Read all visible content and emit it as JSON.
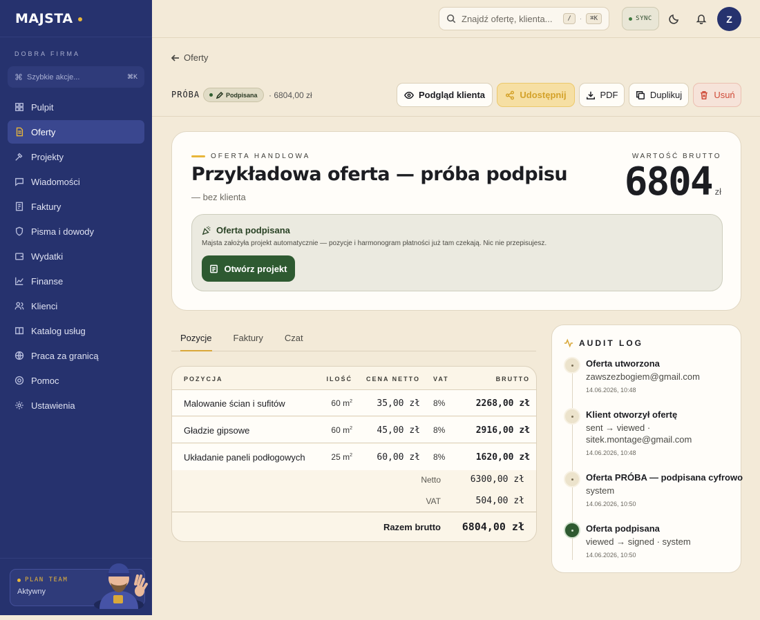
{
  "sidebar": {
    "brand": "MAJSTA",
    "org_label": "DOBRA FIRMA",
    "quick_actions": {
      "placeholder": "Szybkie akcje...",
      "shortcut": "⌘K"
    },
    "items": [
      {
        "label": "Pulpit",
        "icon": "dashboard-icon"
      },
      {
        "label": "Oferty",
        "icon": "document-icon",
        "active": true
      },
      {
        "label": "Projekty",
        "icon": "hammer-icon"
      },
      {
        "label": "Wiadomości",
        "icon": "message-icon"
      },
      {
        "label": "Faktury",
        "icon": "invoice-icon"
      },
      {
        "label": "Pisma i dowody",
        "icon": "shield-icon"
      },
      {
        "label": "Wydatki",
        "icon": "wallet-icon"
      },
      {
        "label": "Finanse",
        "icon": "chart-icon"
      },
      {
        "label": "Klienci",
        "icon": "users-icon"
      },
      {
        "label": "Katalog usług",
        "icon": "book-icon"
      },
      {
        "label": "Praca za granicą",
        "icon": "globe-icon"
      },
      {
        "label": "Pomoc",
        "icon": "help-icon"
      },
      {
        "label": "Ustawienia",
        "icon": "gear-icon"
      }
    ],
    "plan": {
      "tag": "PLAN TEAM",
      "status": "Aktywny"
    }
  },
  "topbar": {
    "search_placeholder": "Znajdź ofertę, klienta...",
    "search_key1": "/",
    "search_sep": "·",
    "search_key2": "⌘K",
    "sync_label": "SYNC",
    "avatar_initial": "Z"
  },
  "header": {
    "back_label": "Oferty",
    "doc_code": "PRÓBA",
    "status": "Podpisana",
    "amount": "· 6804,00 zł",
    "buttons": {
      "preview": "Podgląd klienta",
      "share": "Udostępnij",
      "pdf": "PDF",
      "duplicate": "Duplikuj",
      "delete": "Usuń"
    }
  },
  "offer": {
    "eyebrow": "OFERTA HANDLOWA",
    "title": "Przykładowa oferta — próba podpisu",
    "client": "— bez klienta",
    "gross_label": "WARTOŚĆ BRUTTO",
    "gross_value": "6804",
    "gross_currency": "zł",
    "signed": {
      "title": "Oferta podpisana",
      "description": "Majsta założyła projekt automatycznie — pozycje i harmonogram płatności już tam czekają. Nic nie przepisujesz.",
      "button": "Otwórz projekt"
    }
  },
  "tabs": [
    "Pozycje",
    "Faktury",
    "Czat"
  ],
  "items_table": {
    "headers": {
      "position": "POZYCJA",
      "qty": "ILOŚĆ",
      "net": "CENA NETTO",
      "vat": "VAT",
      "gross": "BRUTTO"
    },
    "rows": [
      {
        "name": "Malowanie ścian i sufitów",
        "qty": "60 m",
        "qty_sup": "2",
        "net": "35,00 zł",
        "vat": "8%",
        "gross": "2268,00 zł"
      },
      {
        "name": "Gładzie gipsowe",
        "qty": "60 m",
        "qty_sup": "2",
        "net": "45,00 zł",
        "vat": "8%",
        "gross": "2916,00 zł"
      },
      {
        "name": "Układanie paneli podłogowych",
        "qty": "25 m",
        "qty_sup": "2",
        "net": "60,00 zł",
        "vat": "8%",
        "gross": "1620,00 zł"
      }
    ],
    "summary": {
      "net_label": "Netto",
      "net_value": "6300,00 zł",
      "vat_label": "VAT",
      "vat_value": "504,00 zł",
      "total_label": "Razem brutto",
      "total_value": "6804,00 zł"
    }
  },
  "audit_log": {
    "title": "AUDIT LOG",
    "events": [
      {
        "title": "Oferta utworzona",
        "body": "zawszezbogiem@gmail.com",
        "time": "14.06.2026, 10:48"
      },
      {
        "title": "Klient otworzył ofertę",
        "body": "sent → viewed · sitek.montage@gmail.com",
        "time": "14.06.2026, 10:48"
      },
      {
        "title": "Oferta PRÓBA — podpisana cyfrowo",
        "body": "system",
        "time": "14.06.2026, 10:50"
      },
      {
        "title": "Oferta podpisana",
        "body": "viewed → signed · system",
        "time": "14.06.2026, 10:50"
      }
    ]
  },
  "colors": {
    "sidebar": "#26326e",
    "accent": "#e8b63a",
    "success": "#2e5a31",
    "danger": "#cf4a37",
    "background": "#f3ead8"
  }
}
